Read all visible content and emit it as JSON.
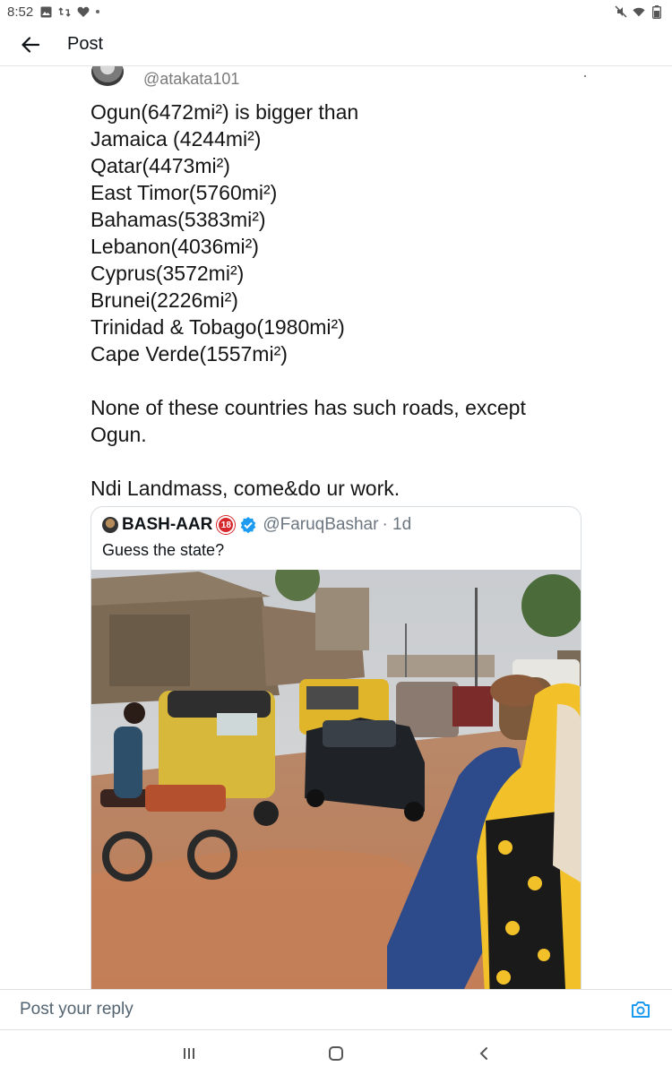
{
  "status_bar": {
    "time": "8:52",
    "icons_left": [
      "gallery-icon",
      "retweet-icon",
      "heart-icon",
      "dot-icon"
    ],
    "icons_right": [
      "mute-icon",
      "wifi-icon",
      "battery-icon"
    ]
  },
  "header": {
    "title": "Post",
    "back_icon": "back-arrow-icon"
  },
  "post": {
    "author_handle": "@atakata101",
    "text_lines": [
      "Ogun(6472mi²) is bigger than",
      "Jamaica (4244mi²)",
      "Qatar(4473mi²)",
      "East Timor(5760mi²)",
      "Bahamas(5383mi²)",
      "Lebanon(4036mi²)",
      "Cyprus(3572mi²)",
      "Brunei(2226mi²)",
      "Trinidad & Tobago(1980mi²)",
      "Cape Verde(1557mi²)",
      "",
      "None of these countries has such roads, except",
      "Ogun.",
      "",
      "Ndi Landmass, come&do ur work."
    ],
    "quoted": {
      "name": "BASH-AAR",
      "badge": "18",
      "handle": "@FaruqBashar",
      "time": "· 1d",
      "text": "Guess the state?",
      "media_description_icon": "photo-muddy-road"
    }
  },
  "reply_bar": {
    "placeholder": "Post your reply",
    "camera_icon": "camera-icon"
  },
  "nav_bar": {
    "buttons": [
      "recents-icon",
      "home-icon",
      "back-icon"
    ]
  }
}
